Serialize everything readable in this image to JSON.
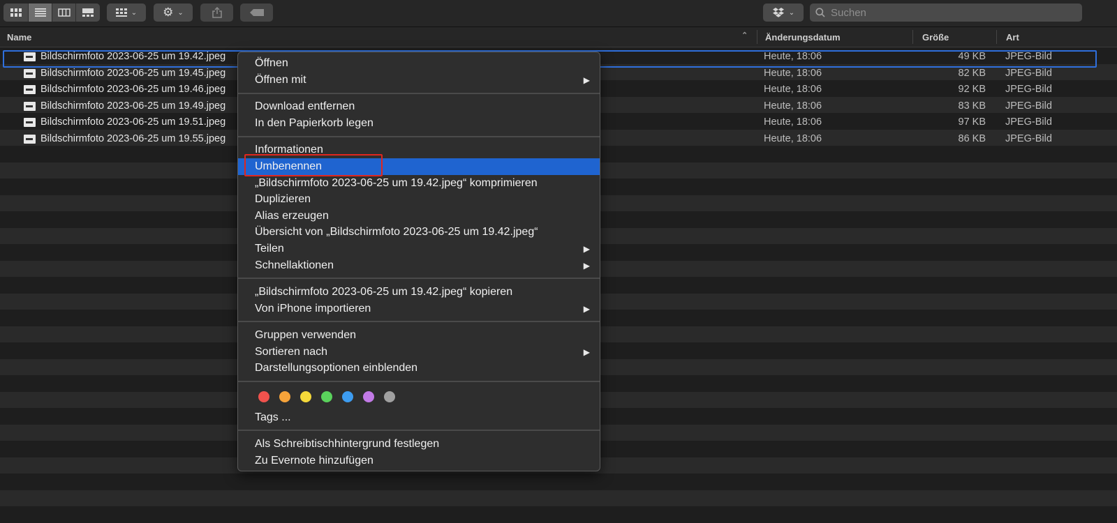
{
  "search": {
    "placeholder": "Suchen"
  },
  "columns": {
    "name": "Name",
    "date": "Änderungsdatum",
    "size": "Größe",
    "kind": "Art"
  },
  "files": [
    {
      "name": "Bildschirmfoto 2023-06-25 um 19.42.jpeg",
      "date": "Heute, 18:06",
      "size": "49 KB",
      "kind": "JPEG-Bild"
    },
    {
      "name": "Bildschirmfoto 2023-06-25 um 19.45.jpeg",
      "date": "Heute, 18:06",
      "size": "82 KB",
      "kind": "JPEG-Bild"
    },
    {
      "name": "Bildschirmfoto 2023-06-25 um 19.46.jpeg",
      "date": "Heute, 18:06",
      "size": "92 KB",
      "kind": "JPEG-Bild"
    },
    {
      "name": "Bildschirmfoto 2023-06-25 um 19.49.jpeg",
      "date": "Heute, 18:06",
      "size": "83 KB",
      "kind": "JPEG-Bild"
    },
    {
      "name": "Bildschirmfoto 2023-06-25 um 19.51.jpeg",
      "date": "Heute, 18:06",
      "size": "97 KB",
      "kind": "JPEG-Bild"
    },
    {
      "name": "Bildschirmfoto 2023-06-25 um 19.55.jpeg",
      "date": "Heute, 18:06",
      "size": "86 KB",
      "kind": "JPEG-Bild"
    }
  ],
  "menu": {
    "open": "Öffnen",
    "open_with": "Öffnen mit",
    "remove_download": "Download entfernen",
    "move_to_trash": "In den Papierkorb legen",
    "get_info": "Informationen",
    "rename": "Umbenennen",
    "compress": "„Bildschirmfoto 2023-06-25 um 19.42.jpeg“ komprimieren",
    "duplicate": "Duplizieren",
    "make_alias": "Alias erzeugen",
    "quick_look": "Übersicht von „Bildschirmfoto 2023-06-25 um 19.42.jpeg“",
    "share": "Teilen",
    "quick_actions": "Schnellaktionen",
    "copy": "„Bildschirmfoto 2023-06-25 um 19.42.jpeg“ kopieren",
    "import_iphone": "Von iPhone importieren",
    "use_groups": "Gruppen verwenden",
    "sort_by": "Sortieren nach",
    "show_view_options": "Darstellungsoptionen einblenden",
    "tags": "Tags ...",
    "set_desktop": "Als Schreibtischhintergrund festlegen",
    "evernote": "Zu Evernote hinzufügen"
  },
  "tag_colors": [
    "#f0524d",
    "#f6a33a",
    "#f5d93a",
    "#5ad25c",
    "#3d9cf0",
    "#c27ae6",
    "#a0a0a0"
  ],
  "icons": {
    "view_icons": "grid-icon",
    "view_list": "list-icon",
    "view_columns": "columns-icon",
    "view_gallery": "gallery-icon",
    "group": "group-icon",
    "action": "gear-icon",
    "share": "share-icon",
    "tag": "tag-icon",
    "dropbox": "dropbox-icon",
    "search": "search-icon"
  }
}
